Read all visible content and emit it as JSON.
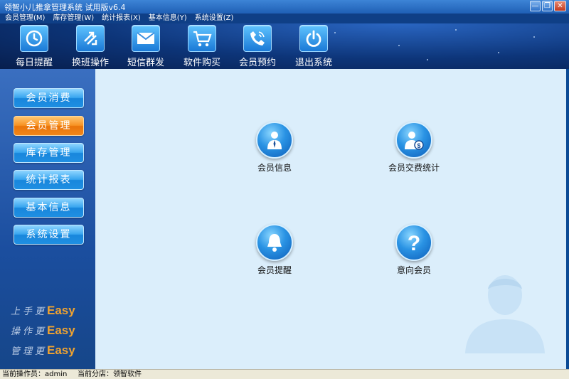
{
  "window": {
    "title": "领智小儿推拿管理系统 试用版v6.4",
    "minimize": "—",
    "restore": "❐",
    "close": "✕"
  },
  "menu": [
    {
      "label": "会员管理(M)"
    },
    {
      "label": "库存管理(W)"
    },
    {
      "label": "统计报表(X)"
    },
    {
      "label": "基本信息(Y)"
    },
    {
      "label": "系统设置(Z)"
    }
  ],
  "toolbar": [
    {
      "label": "每日提醒",
      "icon": "clock-icon"
    },
    {
      "label": "换班操作",
      "icon": "swap-arrows-icon"
    },
    {
      "label": "短信群发",
      "icon": "envelope-icon"
    },
    {
      "label": "软件购买",
      "icon": "shopping-cart-icon"
    },
    {
      "label": "会员预约",
      "icon": "phone-icon"
    },
    {
      "label": "退出系统",
      "icon": "power-icon"
    }
  ],
  "sidebar": {
    "items": [
      {
        "label": "会员消费",
        "active": false
      },
      {
        "label": "会员管理",
        "active": true
      },
      {
        "label": "库存管理",
        "active": false
      },
      {
        "label": "统计报表",
        "active": false
      },
      {
        "label": "基本信息",
        "active": false
      },
      {
        "label": "系统设置",
        "active": false
      }
    ],
    "slogans": [
      {
        "prefix": "上手更",
        "easy": "Easy"
      },
      {
        "prefix": "操作更",
        "easy": "Easy"
      },
      {
        "prefix": "管理更",
        "easy": "Easy"
      }
    ]
  },
  "main": {
    "functions": [
      {
        "label": "会员信息",
        "icon": "member-person-icon"
      },
      {
        "label": "会员交费统计",
        "icon": "member-payment-icon"
      },
      {
        "label": "会员提醒",
        "icon": "bell-icon"
      },
      {
        "label": "意向会员",
        "icon": "question-mark-icon"
      }
    ]
  },
  "status": {
    "operator": "当前操作员：admin",
    "branch": "当前分店：领智软件"
  },
  "colors": {
    "accent": "#1886dc",
    "active": "#f79223",
    "main_bg": "#dbeefb"
  }
}
